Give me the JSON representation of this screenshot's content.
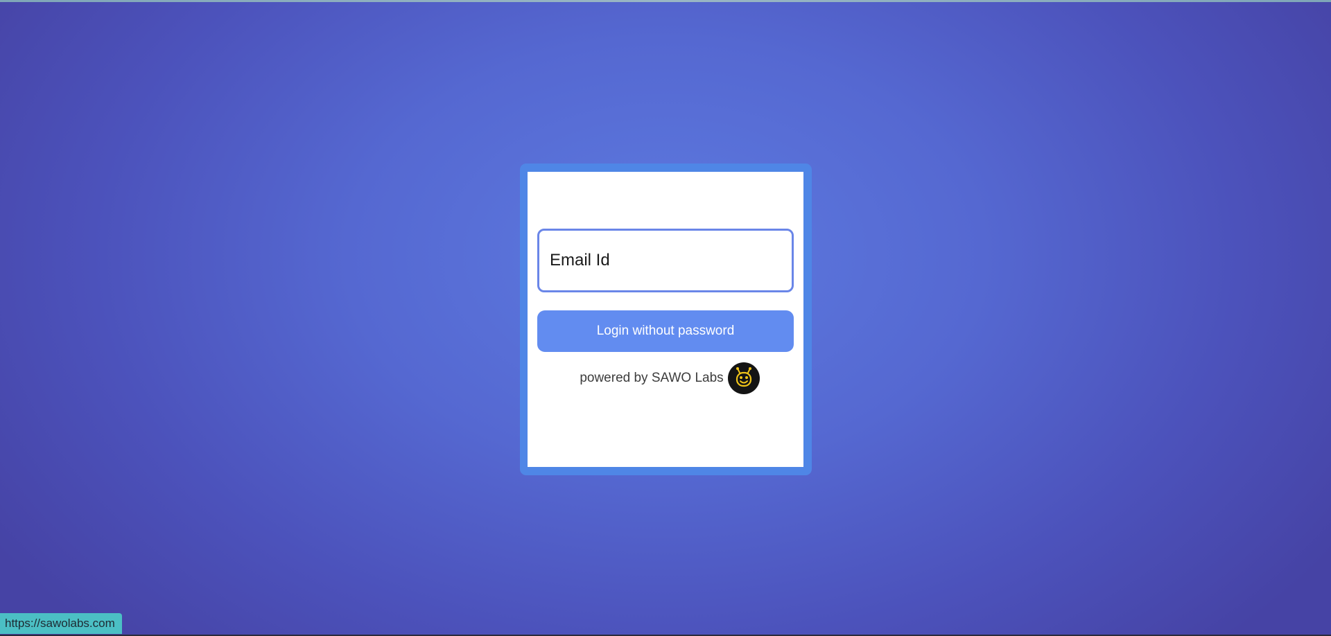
{
  "login_form": {
    "email_placeholder": "Email Id",
    "login_button_label": "Login without password"
  },
  "branding": {
    "powered_by_text": "powered by SAWO Labs",
    "logo_icon": "sawo-bee-logo-icon"
  },
  "status_bar": {
    "url": "https://sawolabs.com"
  },
  "colors": {
    "background_center": "#5d7ae0",
    "background_edge": "#4643a5",
    "card_frame": "#4f86e6",
    "input_border": "#6a86e8",
    "button": "#628cf0",
    "logo_background": "#141414",
    "logo_accent": "#f0c419",
    "status_bar": "#4bbfc4"
  }
}
